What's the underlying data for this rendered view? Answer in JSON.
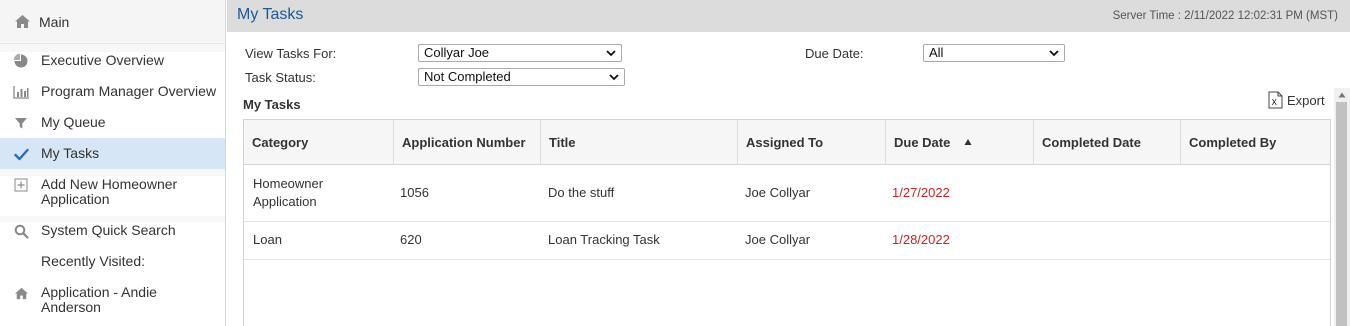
{
  "sidebar": {
    "main_label": "Main",
    "items": [
      {
        "label": "Executive Overview",
        "icon": "pie-chart-icon"
      },
      {
        "label": "Program Manager Overview",
        "icon": "bar-chart-icon"
      },
      {
        "label": "My Queue",
        "icon": "filter-icon"
      },
      {
        "label": "My Tasks",
        "icon": "checkmark-icon"
      },
      {
        "label": "Add New Homeowner Application",
        "icon": "plus-square-icon"
      },
      {
        "label": "System Quick Search",
        "icon": "search-icon"
      },
      {
        "label": "Recently Visited:",
        "icon": ""
      },
      {
        "label": "Application - Andie Anderson",
        "icon": "home-icon"
      }
    ]
  },
  "header": {
    "title": "My Tasks",
    "server_time": "Server Time : 2/11/2022 12:02:31 PM (MST)"
  },
  "filters": {
    "view_tasks_for_label": "View Tasks For:",
    "view_tasks_for_value": "Collyar Joe",
    "task_status_label": "Task Status:",
    "task_status_value": "Not Completed",
    "due_date_label": "Due Date:",
    "due_date_value": "All"
  },
  "tasks": {
    "section_title": "My Tasks",
    "export_label": "Export",
    "columns": [
      "Category",
      "Application Number",
      "Title",
      "Assigned To",
      "Due Date",
      "Completed Date",
      "Completed By"
    ],
    "sorted_column": "Due Date",
    "sort_direction": "ascending",
    "rows": [
      {
        "category": "Homeowner Application",
        "application_number": "1056",
        "title": "Do the stuff",
        "assigned_to": "Joe Collyar",
        "due_date": "1/27/2022",
        "completed_date": "",
        "completed_by": ""
      },
      {
        "category": "Loan",
        "application_number": "620",
        "title": "Loan Tracking Task",
        "assigned_to": "Joe Collyar",
        "due_date": "1/28/2022",
        "completed_date": "",
        "completed_by": ""
      }
    ]
  },
  "colors": {
    "accent": "#1d5a96",
    "active_item_bg": "#d6e6f7",
    "overdue_date": "#d42020",
    "icon_gray": "#888888",
    "check_blue": "#2a6db5"
  }
}
